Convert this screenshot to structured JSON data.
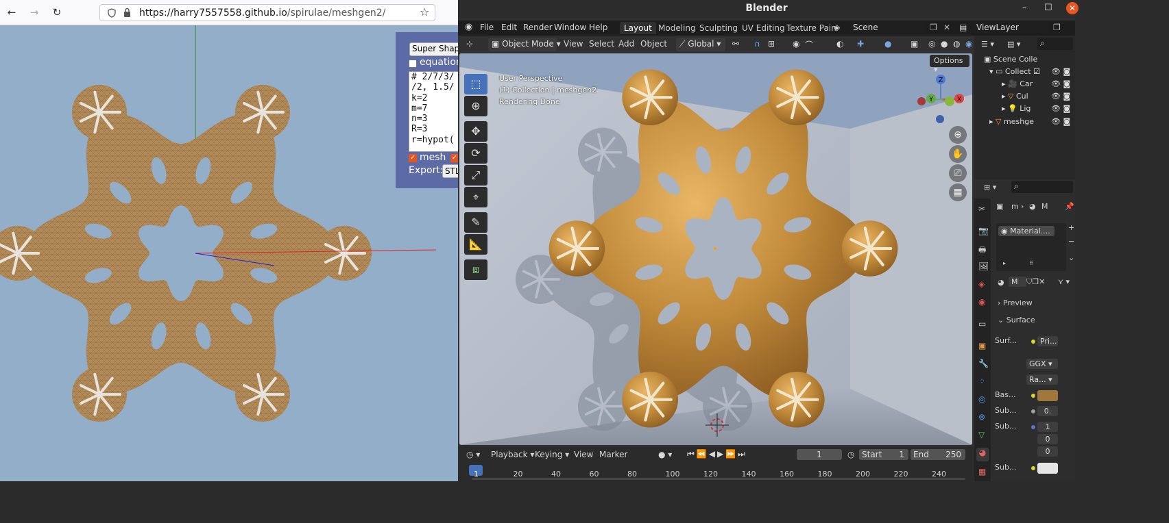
{
  "browser": {
    "url_host": "https://harry7557558.github.io",
    "url_path": "/spirulae/meshgen2/",
    "panel": {
      "shape_button": "Super Shape",
      "equation_label": "equation",
      "equation_lines": [
        "# 2/7/3/",
        "/2, 1.5/",
        "k=2",
        "m=7",
        "n=3",
        "R=3",
        "r=hypot("
      ],
      "mesh_label": "mesh",
      "export_label": "Export:",
      "export_format": "STL"
    }
  },
  "blender": {
    "title": "Blender",
    "menu": [
      "File",
      "Edit",
      "Render",
      "Window",
      "Help"
    ],
    "workspaces": [
      "Layout",
      "Modeling",
      "Sculpting",
      "UV Editing",
      "Texture Pain"
    ],
    "active_workspace": "Layout",
    "scene": "Scene",
    "view_layer": "ViewLayer",
    "viewport": {
      "mode": "Object Mode",
      "menus": [
        "View",
        "Select",
        "Add",
        "Object"
      ],
      "orientation": "Global",
      "options": "Options",
      "info_lines": [
        "User Perspective",
        "(1) Collection | meshgen2",
        "Rendering Done"
      ],
      "gizmo": {
        "x": "X",
        "y": "Y",
        "z": "Z"
      }
    },
    "timeline": {
      "menus": [
        "Playback",
        "Keying",
        "View",
        "Marker"
      ],
      "current_frame": "1",
      "start_label": "Start",
      "start": "1",
      "end_label": "End",
      "end": "250",
      "ticks": [
        "1",
        "20",
        "40",
        "60",
        "80",
        "100",
        "120",
        "140",
        "160",
        "180",
        "200",
        "220",
        "240"
      ]
    },
    "outliner": {
      "items": [
        "Scene Colle",
        "Collect",
        "Car",
        "Cul",
        "Lig",
        "meshge"
      ]
    },
    "properties": {
      "breadcrumb": [
        "m",
        "M"
      ],
      "material_slot": "Material....",
      "material_short": "M",
      "preview_label": "Preview",
      "surface_label": "Surface",
      "rows": [
        {
          "label": "Surf...",
          "value": "Pri..."
        },
        {
          "label": "",
          "value": "GGX"
        },
        {
          "label": "",
          "value": "Ra..."
        },
        {
          "label": "Bas...",
          "value": ""
        },
        {
          "label": "Sub...",
          "value": "0."
        },
        {
          "label": "Sub...",
          "value": "1"
        },
        {
          "label": "",
          "value": "0"
        },
        {
          "label": "",
          "value": "0"
        },
        {
          "label": "Sub...",
          "value": ""
        }
      ],
      "base_color": "#a0773c"
    }
  }
}
